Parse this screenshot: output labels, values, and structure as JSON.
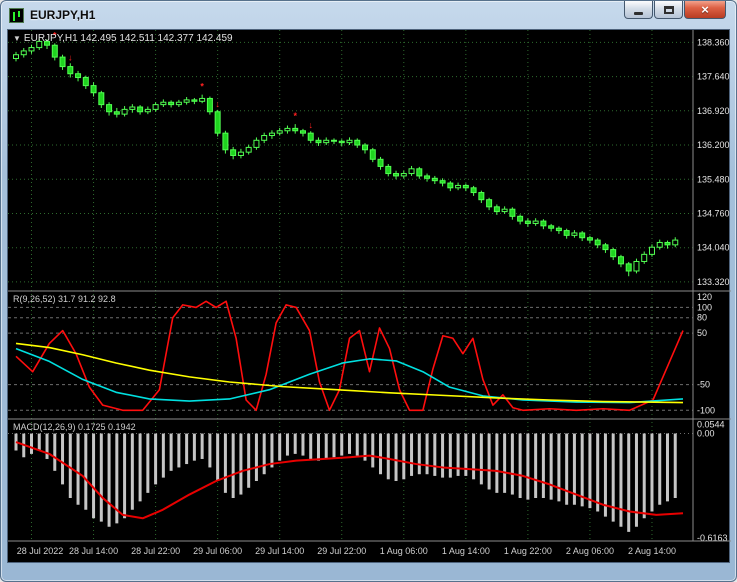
{
  "window": {
    "title": "EURJPY,H1",
    "close_glyph": "×"
  },
  "colors": {
    "background": "#000000",
    "grid": "#2e6b2e",
    "candle_stroke": "#52ff52",
    "candle_fill": "#1fd41f",
    "signal_red": "#ff2020",
    "r_red": "#ff0e0e",
    "r_cyan": "#00e0e0",
    "r_yellow": "#ffff00",
    "macd_bar": "#c6c6c6",
    "macd_line": "#e80000",
    "separator": "#8c8c8c",
    "level": "#6e6e6e",
    "axis_text": "#e4e4e4",
    "time_text": "#cfcfcf"
  },
  "chart_data": [
    {
      "type": "candlestick",
      "title": "EURJPY,H1",
      "readout": "EURJPY,H1 142.495 142.511 142.377 142.459",
      "collapse_glyph": "▼",
      "ylim": [
        133.15,
        138.62
      ],
      "y_ticks": [
        "138.360",
        "137.640",
        "136.920",
        "136.200",
        "135.480",
        "134.760",
        "134.040",
        "133.320"
      ],
      "x_labels": [
        "28 Jul 2022",
        "28 Jul 14:00",
        "28 Jul 22:00",
        "29 Jul 06:00",
        "29 Jul 14:00",
        "29 Jul 22:00",
        "1 Aug 06:00",
        "1 Aug 14:00",
        "1 Aug 22:00",
        "2 Aug 06:00",
        "2 Aug 14:00"
      ],
      "signals": [
        {
          "type": "star",
          "index": 5
        },
        {
          "type": "arrow",
          "index": 7
        },
        {
          "type": "star",
          "index": 24
        },
        {
          "type": "arrow",
          "index": 26
        },
        {
          "type": "star",
          "index": 36
        },
        {
          "type": "arrow",
          "index": 38
        }
      ],
      "candles": [
        [
          138.02,
          138.16,
          137.96,
          138.1
        ],
        [
          138.1,
          138.24,
          138.04,
          138.18
        ],
        [
          138.18,
          138.31,
          138.12,
          138.25
        ],
        [
          138.25,
          138.44,
          138.2,
          138.38
        ],
        [
          138.38,
          138.42,
          138.22,
          138.3
        ],
        [
          138.3,
          138.34,
          137.98,
          138.05
        ],
        [
          138.05,
          138.1,
          137.78,
          137.85
        ],
        [
          137.85,
          137.92,
          137.62,
          137.7
        ],
        [
          137.7,
          137.76,
          137.54,
          137.62
        ],
        [
          137.62,
          137.66,
          137.38,
          137.45
        ],
        [
          137.45,
          137.52,
          137.22,
          137.3
        ],
        [
          137.3,
          137.34,
          136.98,
          137.05
        ],
        [
          137.05,
          137.1,
          136.82,
          136.9
        ],
        [
          136.9,
          136.98,
          136.78,
          136.85
        ],
        [
          136.85,
          137.02,
          136.8,
          136.95
        ],
        [
          136.95,
          137.06,
          136.88,
          137.0
        ],
        [
          137.0,
          137.04,
          136.84,
          136.9
        ],
        [
          136.9,
          137.01,
          136.85,
          136.95
        ],
        [
          136.95,
          137.1,
          136.9,
          137.05
        ],
        [
          137.05,
          137.16,
          137.0,
          137.1
        ],
        [
          137.1,
          137.14,
          136.99,
          137.05
        ],
        [
          137.05,
          137.15,
          137.0,
          137.1
        ],
        [
          137.1,
          137.21,
          137.05,
          137.15
        ],
        [
          137.15,
          137.19,
          137.06,
          137.12
        ],
        [
          137.12,
          137.26,
          137.08,
          137.18
        ],
        [
          137.18,
          137.22,
          136.84,
          136.9
        ],
        [
          136.9,
          136.94,
          136.38,
          136.45
        ],
        [
          136.45,
          136.5,
          136.02,
          136.1
        ],
        [
          136.1,
          136.16,
          135.9,
          135.98
        ],
        [
          135.98,
          136.12,
          135.92,
          136.05
        ],
        [
          136.05,
          136.21,
          136.0,
          136.15
        ],
        [
          136.15,
          136.36,
          136.1,
          136.3
        ],
        [
          136.3,
          136.46,
          136.24,
          136.4
        ],
        [
          136.4,
          136.51,
          136.33,
          136.45
        ],
        [
          136.45,
          136.56,
          136.4,
          136.5
        ],
        [
          136.5,
          136.61,
          136.44,
          136.55
        ],
        [
          136.55,
          136.64,
          136.44,
          136.5
        ],
        [
          136.5,
          136.54,
          136.38,
          136.45
        ],
        [
          136.45,
          136.49,
          136.24,
          136.3
        ],
        [
          136.3,
          136.36,
          136.18,
          136.25
        ],
        [
          136.25,
          136.36,
          136.2,
          136.3
        ],
        [
          136.3,
          136.34,
          136.22,
          136.28
        ],
        [
          136.28,
          136.32,
          136.18,
          136.25
        ],
        [
          136.25,
          136.36,
          136.2,
          136.3
        ],
        [
          136.3,
          136.34,
          136.14,
          136.2
        ],
        [
          136.2,
          136.24,
          136.02,
          136.1
        ],
        [
          136.1,
          136.14,
          135.84,
          135.9
        ],
        [
          135.9,
          135.95,
          135.68,
          135.75
        ],
        [
          135.75,
          135.8,
          135.54,
          135.6
        ],
        [
          135.6,
          135.66,
          135.48,
          135.55
        ],
        [
          135.55,
          135.66,
          135.5,
          135.6
        ],
        [
          135.6,
          135.76,
          135.55,
          135.7
        ],
        [
          135.7,
          135.74,
          135.49,
          135.55
        ],
        [
          135.55,
          135.6,
          135.43,
          135.5
        ],
        [
          135.5,
          135.55,
          135.38,
          135.45
        ],
        [
          135.45,
          135.5,
          135.33,
          135.4
        ],
        [
          135.4,
          135.44,
          135.23,
          135.3
        ],
        [
          135.3,
          135.41,
          135.25,
          135.35
        ],
        [
          135.35,
          135.39,
          135.23,
          135.3
        ],
        [
          135.3,
          135.34,
          135.13,
          135.2
        ],
        [
          135.2,
          135.24,
          134.98,
          135.05
        ],
        [
          135.05,
          135.09,
          134.83,
          134.9
        ],
        [
          134.9,
          134.95,
          134.73,
          134.8
        ],
        [
          134.8,
          134.91,
          134.75,
          134.85
        ],
        [
          134.85,
          134.89,
          134.63,
          134.7
        ],
        [
          134.7,
          134.74,
          134.53,
          134.6
        ],
        [
          134.6,
          134.66,
          134.48,
          134.55
        ],
        [
          134.55,
          134.66,
          134.5,
          134.6
        ],
        [
          134.6,
          134.64,
          134.43,
          134.5
        ],
        [
          134.5,
          134.54,
          134.38,
          134.45
        ],
        [
          134.45,
          134.49,
          134.33,
          134.4
        ],
        [
          134.4,
          134.44,
          134.23,
          134.3
        ],
        [
          134.3,
          134.41,
          134.25,
          134.35
        ],
        [
          134.35,
          134.39,
          134.18,
          134.25
        ],
        [
          134.25,
          134.29,
          134.13,
          134.2
        ],
        [
          134.2,
          134.24,
          134.03,
          134.1
        ],
        [
          134.1,
          134.14,
          133.93,
          134.0
        ],
        [
          134.0,
          134.04,
          133.78,
          133.85
        ],
        [
          133.85,
          133.89,
          133.63,
          133.7
        ],
        [
          133.7,
          133.74,
          133.44,
          133.55
        ],
        [
          133.55,
          133.81,
          133.5,
          133.75
        ],
        [
          133.75,
          133.96,
          133.7,
          133.9
        ],
        [
          133.9,
          134.11,
          133.85,
          134.05
        ],
        [
          134.05,
          134.21,
          134.0,
          134.15
        ],
        [
          134.15,
          134.19,
          134.02,
          134.1
        ],
        [
          134.1,
          134.26,
          134.05,
          134.2
        ]
      ]
    },
    {
      "type": "line",
      "label": "R(9,26,52) 31.7 91.2 92.8",
      "ylim": [
        -115,
        130
      ],
      "levels": [
        100,
        80,
        50,
        -50,
        -100
      ],
      "y_ticks": [
        120,
        100,
        80,
        50,
        -50,
        -100
      ],
      "series": [
        {
          "name": "fast",
          "color_key": "r_red",
          "points": [
            [
              0,
              5
            ],
            [
              0.025,
              -25
            ],
            [
              0.05,
              30
            ],
            [
              0.07,
              55
            ],
            [
              0.09,
              10
            ],
            [
              0.11,
              -55
            ],
            [
              0.13,
              -90
            ],
            [
              0.16,
              -100
            ],
            [
              0.19,
              -100
            ],
            [
              0.215,
              -60
            ],
            [
              0.235,
              80
            ],
            [
              0.25,
              105
            ],
            [
              0.27,
              100
            ],
            [
              0.285,
              112
            ],
            [
              0.3,
              100
            ],
            [
              0.315,
              112
            ],
            [
              0.33,
              40
            ],
            [
              0.345,
              -80
            ],
            [
              0.36,
              -100
            ],
            [
              0.375,
              -30
            ],
            [
              0.39,
              70
            ],
            [
              0.405,
              105
            ],
            [
              0.42,
              100
            ],
            [
              0.44,
              55
            ],
            [
              0.455,
              -45
            ],
            [
              0.47,
              -100
            ],
            [
              0.485,
              -60
            ],
            [
              0.5,
              40
            ],
            [
              0.515,
              55
            ],
            [
              0.53,
              -25
            ],
            [
              0.545,
              60
            ],
            [
              0.56,
              20
            ],
            [
              0.575,
              -60
            ],
            [
              0.59,
              -100
            ],
            [
              0.61,
              -100
            ],
            [
              0.625,
              -20
            ],
            [
              0.64,
              45
            ],
            [
              0.655,
              40
            ],
            [
              0.67,
              10
            ],
            [
              0.685,
              40
            ],
            [
              0.7,
              -40
            ],
            [
              0.715,
              -90
            ],
            [
              0.73,
              -70
            ],
            [
              0.745,
              -95
            ],
            [
              0.76,
              -100
            ],
            [
              0.8,
              -97
            ],
            [
              0.84,
              -100
            ],
            [
              0.88,
              -97
            ],
            [
              0.92,
              -100
            ],
            [
              0.955,
              -80
            ],
            [
              0.975,
              -20
            ],
            [
              1,
              55
            ]
          ]
        },
        {
          "name": "medium",
          "color_key": "r_cyan",
          "points": [
            [
              0,
              20
            ],
            [
              0.05,
              -5
            ],
            [
              0.1,
              -40
            ],
            [
              0.15,
              -65
            ],
            [
              0.2,
              -78
            ],
            [
              0.26,
              -82
            ],
            [
              0.32,
              -78
            ],
            [
              0.38,
              -60
            ],
            [
              0.44,
              -30
            ],
            [
              0.49,
              -8
            ],
            [
              0.53,
              0
            ],
            [
              0.57,
              -4
            ],
            [
              0.61,
              -25
            ],
            [
              0.65,
              -55
            ],
            [
              0.7,
              -72
            ],
            [
              0.76,
              -80
            ],
            [
              0.84,
              -84
            ],
            [
              0.92,
              -85
            ],
            [
              1,
              -78
            ]
          ]
        },
        {
          "name": "slow",
          "color_key": "r_yellow",
          "points": [
            [
              0,
              30
            ],
            [
              0.05,
              22
            ],
            [
              0.1,
              8
            ],
            [
              0.15,
              -8
            ],
            [
              0.2,
              -22
            ],
            [
              0.26,
              -35
            ],
            [
              0.32,
              -45
            ],
            [
              0.4,
              -54
            ],
            [
              0.48,
              -60
            ],
            [
              0.56,
              -66
            ],
            [
              0.64,
              -71
            ],
            [
              0.72,
              -76
            ],
            [
              0.8,
              -80
            ],
            [
              0.88,
              -83
            ],
            [
              1,
              -85
            ]
          ]
        }
      ]
    },
    {
      "type": "macd",
      "label": "MACD(12,26,9) 0.1725 0.1942",
      "ylim": [
        -0.64,
        0.08
      ],
      "y_ticks": [
        {
          "label": "0.0544",
          "value": 0.0544
        },
        {
          "label": "0.00",
          "value": 0.0
        },
        {
          "label": "-0.6163",
          "value": -0.6163
        }
      ],
      "histogram": [
        -0.1,
        -0.14,
        -0.12,
        -0.1,
        -0.15,
        -0.22,
        -0.3,
        -0.38,
        -0.42,
        -0.45,
        -0.5,
        -0.52,
        -0.55,
        -0.53,
        -0.5,
        -0.45,
        -0.4,
        -0.35,
        -0.3,
        -0.26,
        -0.22,
        -0.2,
        -0.18,
        -0.16,
        -0.15,
        -0.2,
        -0.28,
        -0.35,
        -0.38,
        -0.36,
        -0.32,
        -0.28,
        -0.24,
        -0.2,
        -0.16,
        -0.13,
        -0.12,
        -0.13,
        -0.15,
        -0.16,
        -0.15,
        -0.14,
        -0.13,
        -0.12,
        -0.13,
        -0.16,
        -0.2,
        -0.24,
        -0.27,
        -0.28,
        -0.27,
        -0.25,
        -0.24,
        -0.24,
        -0.25,
        -0.26,
        -0.26,
        -0.25,
        -0.25,
        -0.27,
        -0.3,
        -0.33,
        -0.35,
        -0.35,
        -0.36,
        -0.38,
        -0.39,
        -0.38,
        -0.38,
        -0.39,
        -0.4,
        -0.42,
        -0.42,
        -0.43,
        -0.44,
        -0.46,
        -0.49,
        -0.52,
        -0.55,
        -0.58,
        -0.55,
        -0.5,
        -0.46,
        -0.42,
        -0.4,
        -0.38
      ],
      "signal": [
        [
          0,
          -0.05
        ],
        [
          0.05,
          -0.12
        ],
        [
          0.1,
          -0.25
        ],
        [
          0.13,
          -0.38
        ],
        [
          0.16,
          -0.48
        ],
        [
          0.19,
          -0.5
        ],
        [
          0.22,
          -0.45
        ],
        [
          0.26,
          -0.36
        ],
        [
          0.3,
          -0.28
        ],
        [
          0.34,
          -0.22
        ],
        [
          0.38,
          -0.18
        ],
        [
          0.42,
          -0.16
        ],
        [
          0.46,
          -0.15
        ],
        [
          0.5,
          -0.14
        ],
        [
          0.53,
          -0.13
        ],
        [
          0.56,
          -0.15
        ],
        [
          0.6,
          -0.18
        ],
        [
          0.64,
          -0.2
        ],
        [
          0.68,
          -0.21
        ],
        [
          0.72,
          -0.22
        ],
        [
          0.76,
          -0.25
        ],
        [
          0.8,
          -0.3
        ],
        [
          0.84,
          -0.36
        ],
        [
          0.88,
          -0.42
        ],
        [
          0.92,
          -0.46
        ],
        [
          0.96,
          -0.48
        ],
        [
          1,
          -0.47
        ]
      ]
    }
  ]
}
